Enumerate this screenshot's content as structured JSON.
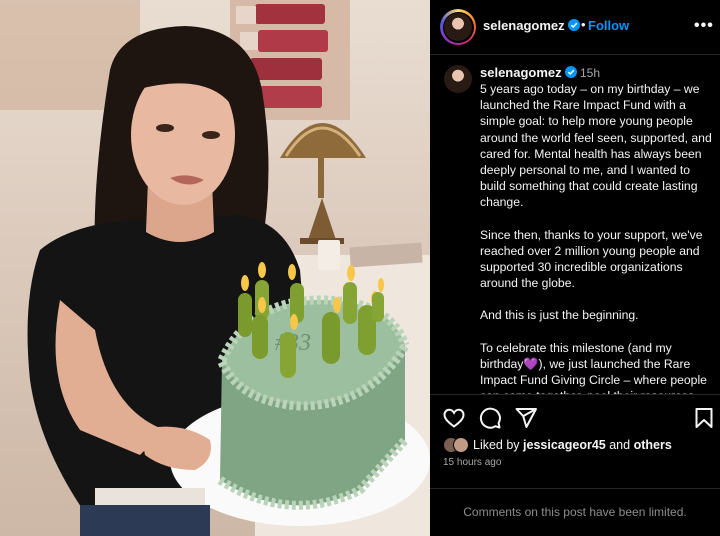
{
  "post": {
    "username": "selenagomez",
    "follow_label": "Follow",
    "separator": "•",
    "more_label": "•••"
  },
  "caption": {
    "username": "selenagomez",
    "time": "15h",
    "paragraphs": [
      "5 years ago today – on my birthday – we launched the Rare Impact Fund with a simple goal: to help more young people around the world feel seen, supported, and cared for. Mental health has always been deeply personal to me, and I wanted to build something that could create lasting change.",
      "Since then, thanks to your support, we've reached over 2 million young people and supported 30 incredible organizations around the globe.",
      "And this is just the beginning.",
      "To celebrate this milestone (and my birthday💜), we just launched the Rare Impact Fund Giving Circle – where people can come together, pool their resources"
    ]
  },
  "engagement": {
    "liked_prefix": "Liked by",
    "liked_user": "jessicageor45",
    "liked_and": "and",
    "liked_others": "others",
    "posted_ago": "15 hours ago"
  },
  "comments_notice": "Comments on this post have been limited.",
  "icons": {
    "verified": "verified-badge-icon",
    "like": "heart-icon",
    "comment": "comment-bubble-icon",
    "share": "paper-plane-icon",
    "save": "bookmark-icon",
    "more": "more-dots-icon"
  },
  "colors": {
    "background": "#000000",
    "link_blue": "#0095f6",
    "text": "#f5f5f5",
    "muted": "#a8a8a8",
    "divider": "#262626"
  }
}
